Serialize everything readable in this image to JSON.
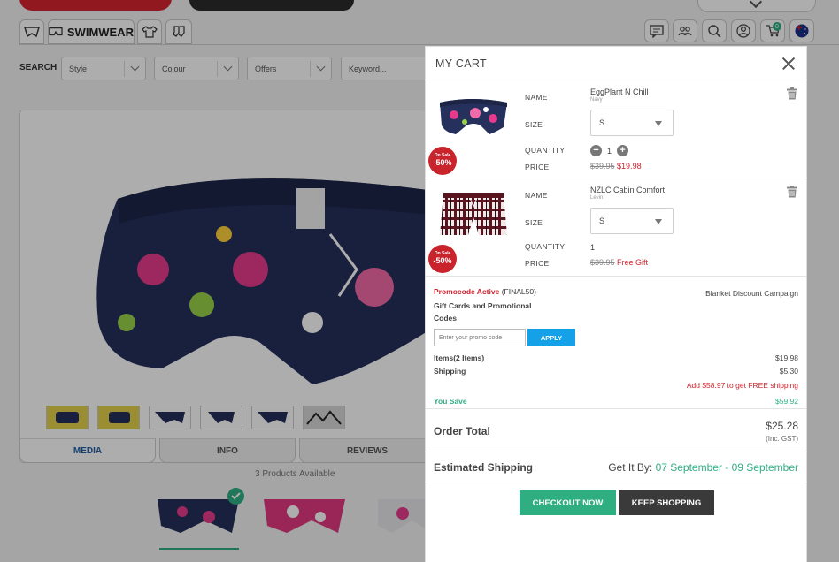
{
  "nav": {
    "swimwear_label": "SWIMWEAR"
  },
  "filters": {
    "search_label": "SEARCH",
    "style": "Style",
    "colour": "Colour",
    "offers": "Offers",
    "keyword_placeholder": "Keyword..."
  },
  "info_tabs": [
    "MEDIA",
    "INFO",
    "REVIEWS"
  ],
  "products_available": "3 Products Available",
  "icons": {
    "cart_count": "0"
  },
  "colors": {
    "accent_green": "#2fae82",
    "sale_red": "#d0242d",
    "apply_blue": "#15a1e8",
    "dark_button": "#3a3a3a"
  },
  "cart": {
    "title": "MY CART",
    "labels": {
      "name": "NAME",
      "size": "SIZE",
      "quantity": "QUANTITY",
      "price": "PRICE"
    },
    "badge": {
      "on_sale": "On Sale",
      "pct": "-50%"
    },
    "items": [
      {
        "name": "EggPlant N Chill",
        "colour": "Navy",
        "size": "S",
        "quantity": "1",
        "old_price": "$39.95",
        "new_price": "$19.98"
      },
      {
        "name": "NZLC Cabin Comfort",
        "colour": "Levin",
        "size": "S",
        "quantity": "1",
        "old_price": "$39.95",
        "new_price": "Free Gift"
      }
    ],
    "promo": {
      "active_label": "Promocode Active",
      "code": "(FINAL50)",
      "campaign": "Blanket Discount Campaign",
      "gift_title": "Gift Cards and Promotional Codes",
      "input_placeholder": "Enter your promo code",
      "apply_label": "APPLY"
    },
    "summary": {
      "items_label": "Items(2 Items)",
      "items_value": "$19.98",
      "shipping_label": "Shipping",
      "shipping_value": "$5.30",
      "free_shipping_note": "Add $58.97 to get FREE shipping",
      "you_save_label": "You Save",
      "you_save_value": "$59.92",
      "order_total_label": "Order Total",
      "order_total_value": "$25.28",
      "gst_note": "(Inc. GST)",
      "est_shipping_label": "Estimated Shipping",
      "get_it_by_label": "Get It By:",
      "get_it_by_dates": "07 September - 09 September"
    },
    "buttons": {
      "checkout": "CHECKOUT NOW",
      "keep_shopping": "KEEP SHOPPING"
    }
  }
}
